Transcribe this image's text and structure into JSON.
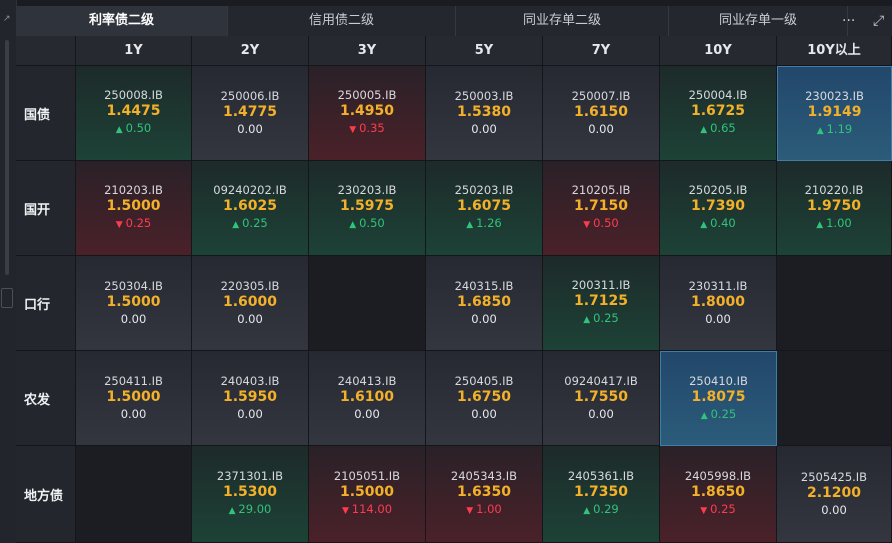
{
  "tabs": [
    {
      "label": "利率债二级",
      "active": true
    },
    {
      "label": "信用债二级",
      "active": false
    },
    {
      "label": "同业存单二级",
      "active": false
    },
    {
      "label": "同业存单一级",
      "active": false
    }
  ],
  "toolbar": {
    "more_icon": "···",
    "expand_icon": "⤢"
  },
  "columns": [
    "1Y",
    "2Y",
    "3Y",
    "5Y",
    "7Y",
    "10Y",
    "10Y以上"
  ],
  "rows": [
    {
      "label": "国债",
      "cells": [
        {
          "code": "250008.IB",
          "yield": "1.4475",
          "change": "0.50",
          "dir": "up"
        },
        {
          "code": "250006.IB",
          "yield": "1.4775",
          "change": "0.00",
          "dir": "flat"
        },
        {
          "code": "250005.IB",
          "yield": "1.4950",
          "change": "0.35",
          "dir": "down"
        },
        {
          "code": "250003.IB",
          "yield": "1.5380",
          "change": "0.00",
          "dir": "flat"
        },
        {
          "code": "250007.IB",
          "yield": "1.6150",
          "change": "0.00",
          "dir": "flat"
        },
        {
          "code": "250004.IB",
          "yield": "1.6725",
          "change": "0.65",
          "dir": "up"
        },
        {
          "code": "230023.IB",
          "yield": "1.9149",
          "change": "1.19",
          "dir": "up",
          "highlight": true
        }
      ]
    },
    {
      "label": "国开",
      "cells": [
        {
          "code": "210203.IB",
          "yield": "1.5000",
          "change": "0.25",
          "dir": "down"
        },
        {
          "code": "09240202.IB",
          "yield": "1.6025",
          "change": "0.25",
          "dir": "up"
        },
        {
          "code": "230203.IB",
          "yield": "1.5975",
          "change": "0.50",
          "dir": "up"
        },
        {
          "code": "250203.IB",
          "yield": "1.6075",
          "change": "1.26",
          "dir": "up"
        },
        {
          "code": "210205.IB",
          "yield": "1.7150",
          "change": "0.50",
          "dir": "down"
        },
        {
          "code": "250205.IB",
          "yield": "1.7390",
          "change": "0.40",
          "dir": "up"
        },
        {
          "code": "210220.IB",
          "yield": "1.9750",
          "change": "1.00",
          "dir": "up"
        }
      ]
    },
    {
      "label": "口行",
      "cells": [
        {
          "code": "250304.IB",
          "yield": "1.5000",
          "change": "0.00",
          "dir": "flat"
        },
        {
          "code": "220305.IB",
          "yield": "1.6000",
          "change": "0.00",
          "dir": "flat"
        },
        null,
        {
          "code": "240315.IB",
          "yield": "1.6850",
          "change": "0.00",
          "dir": "flat"
        },
        {
          "code": "200311.IB",
          "yield": "1.7125",
          "change": "0.25",
          "dir": "up"
        },
        {
          "code": "230311.IB",
          "yield": "1.8000",
          "change": "0.00",
          "dir": "flat"
        },
        null
      ]
    },
    {
      "label": "农发",
      "cells": [
        {
          "code": "250411.IB",
          "yield": "1.5000",
          "change": "0.00",
          "dir": "flat"
        },
        {
          "code": "240403.IB",
          "yield": "1.5950",
          "change": "0.00",
          "dir": "flat"
        },
        {
          "code": "240413.IB",
          "yield": "1.6100",
          "change": "0.00",
          "dir": "flat"
        },
        {
          "code": "250405.IB",
          "yield": "1.6750",
          "change": "0.00",
          "dir": "flat"
        },
        {
          "code": "09240417.IB",
          "yield": "1.7550",
          "change": "0.00",
          "dir": "flat"
        },
        {
          "code": "250410.IB",
          "yield": "1.8075",
          "change": "0.25",
          "dir": "up",
          "highlight": true
        },
        null
      ]
    },
    {
      "label": "地方债",
      "cells": [
        null,
        {
          "code": "2371301.IB",
          "yield": "1.5300",
          "change": "29.00",
          "dir": "up"
        },
        {
          "code": "2105051.IB",
          "yield": "1.5000",
          "change": "114.00",
          "dir": "down"
        },
        {
          "code": "2405343.IB",
          "yield": "1.6350",
          "change": "1.00",
          "dir": "down"
        },
        {
          "code": "2405361.IB",
          "yield": "1.7350",
          "change": "0.29",
          "dir": "up"
        },
        {
          "code": "2405998.IB",
          "yield": "1.8650",
          "change": "0.25",
          "dir": "down"
        },
        {
          "code": "2505425.IB",
          "yield": "2.1200",
          "change": "0.00",
          "dir": "flat"
        }
      ]
    }
  ]
}
